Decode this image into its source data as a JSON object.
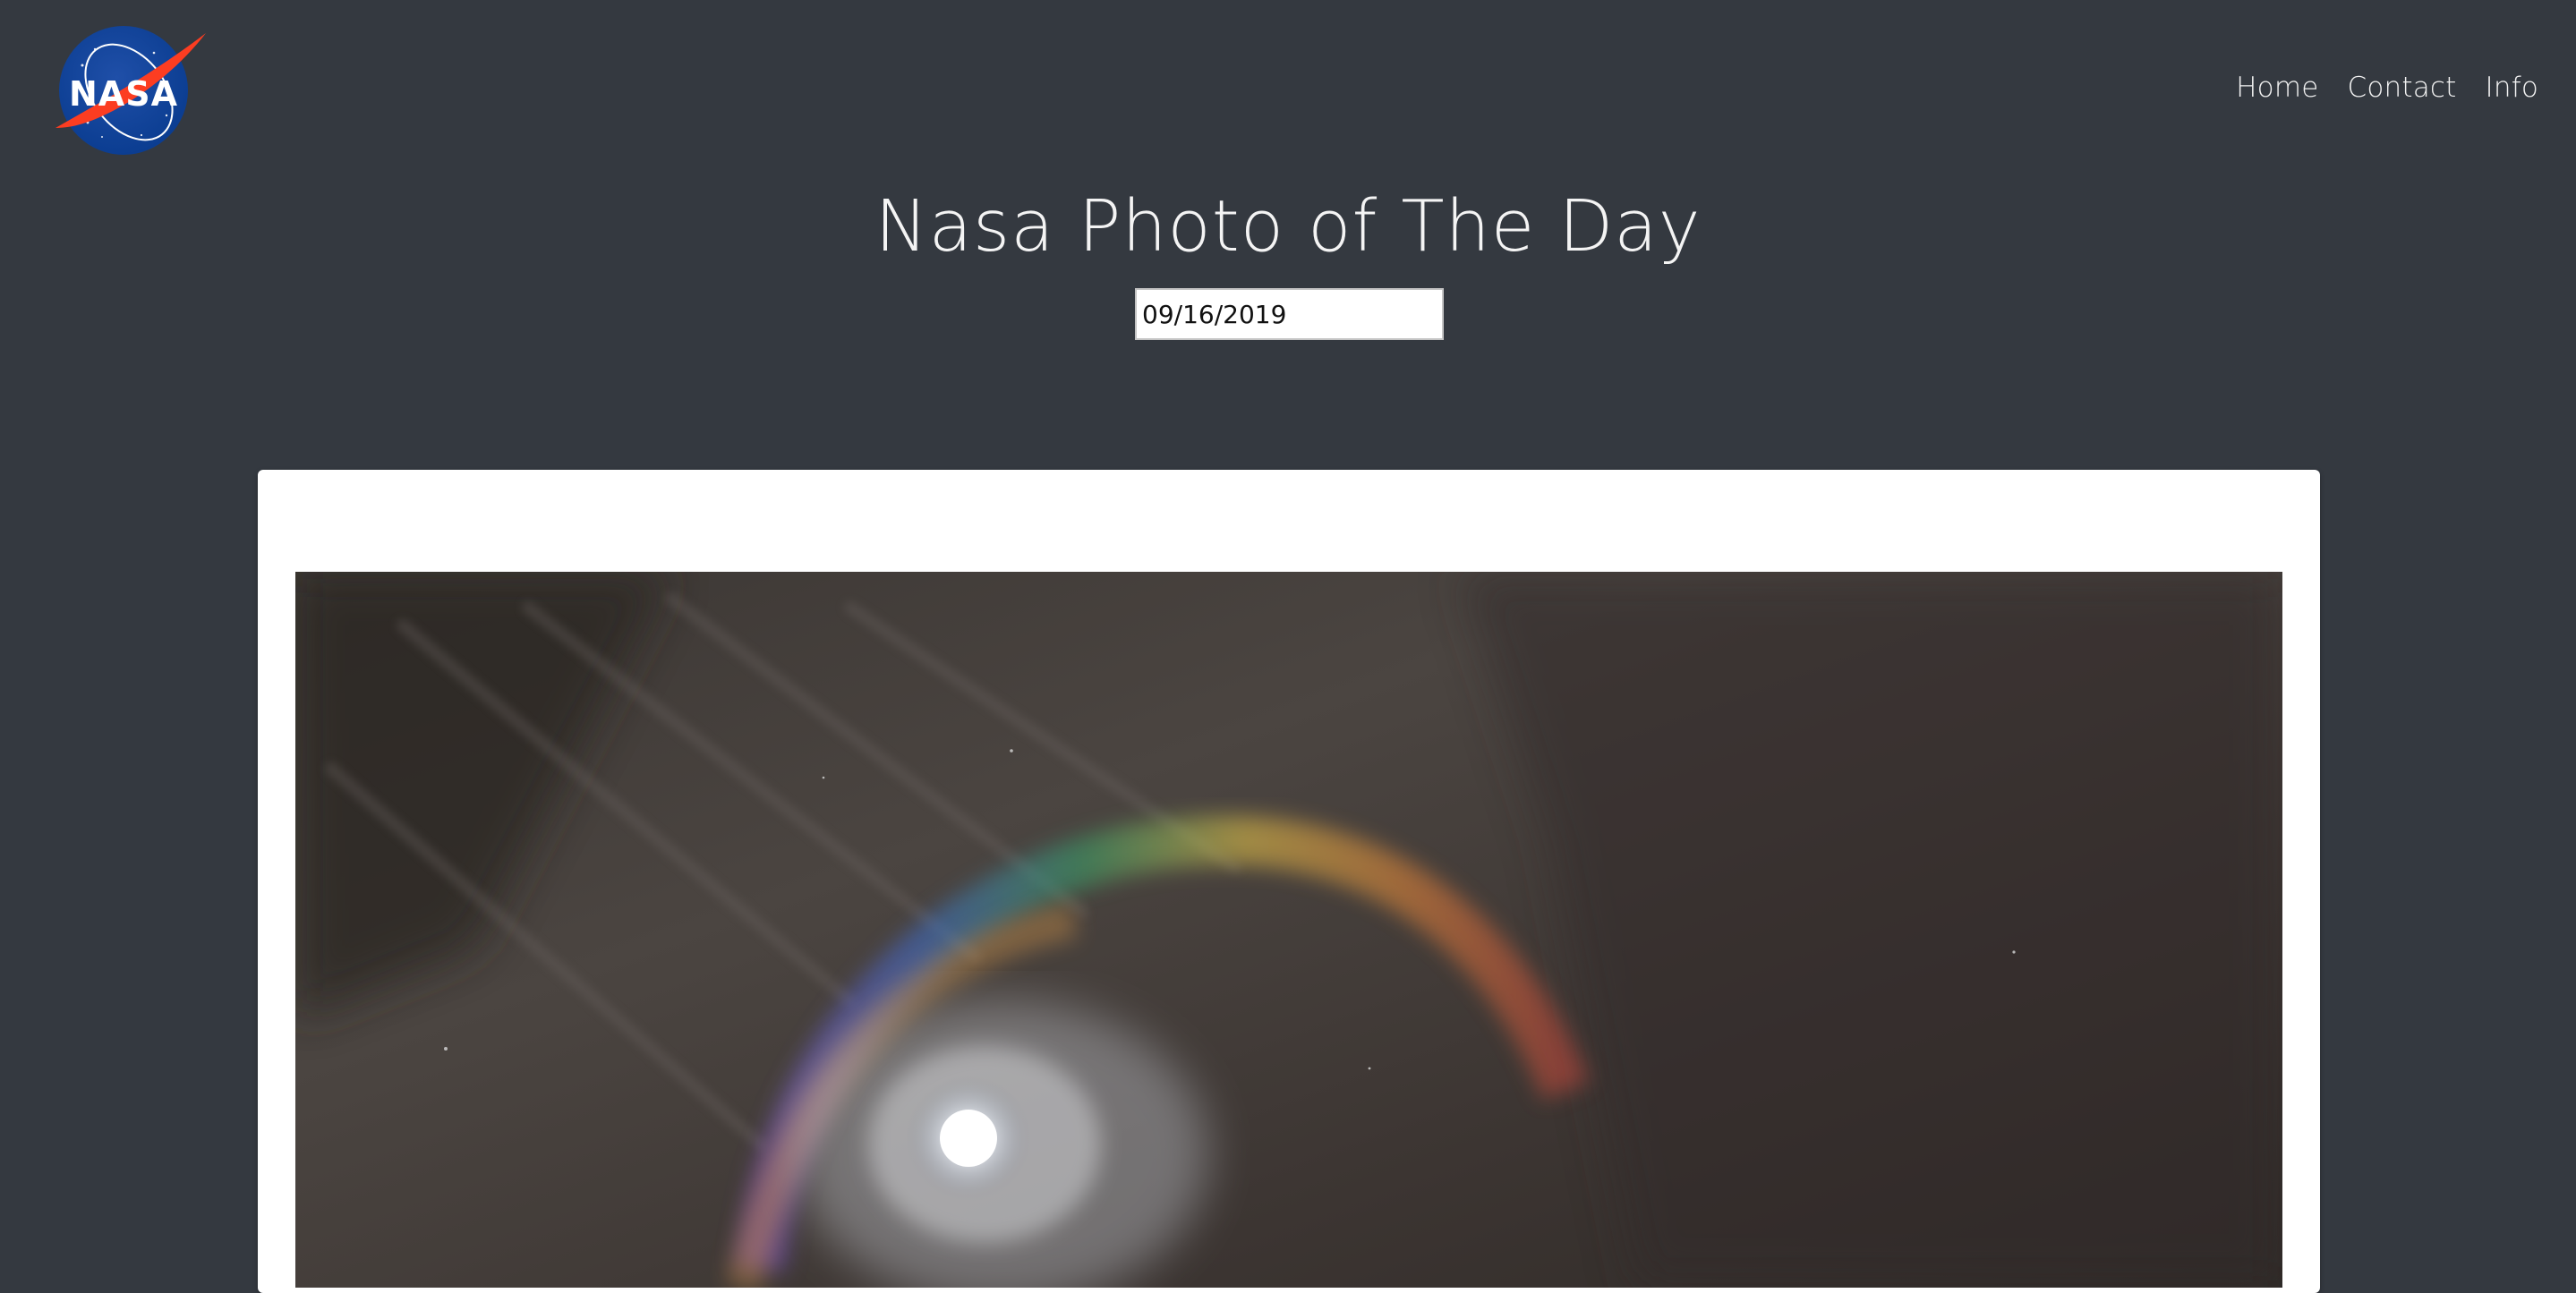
{
  "logo": {
    "text": "NASA"
  },
  "nav": {
    "items": [
      {
        "label": "Home"
      },
      {
        "label": "Contact"
      },
      {
        "label": "Info"
      }
    ]
  },
  "page": {
    "title": "Nasa Photo of The Day"
  },
  "date_picker": {
    "value": "09/16/2019"
  },
  "photo": {
    "subject": "moon-with-iridescent-clouds"
  },
  "colors": {
    "background": "#343940",
    "card": "#ffffff",
    "nav_text": "#f2f2f2",
    "nasa_blue": "#0b3d91",
    "nasa_red": "#fc3d21"
  }
}
